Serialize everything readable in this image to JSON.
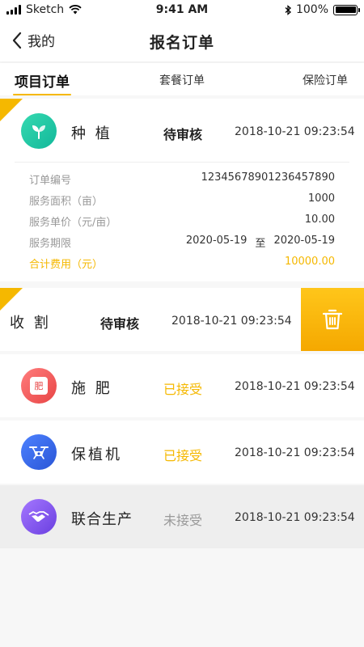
{
  "status_bar": {
    "carrier": "Sketch",
    "time": "9:41 AM",
    "battery": "100%",
    "battery_level": 1.0
  },
  "nav": {
    "back_label": "我的",
    "title": "报名订单"
  },
  "tabs": [
    {
      "label": "项目订单",
      "active": true
    },
    {
      "label": "套餐订单",
      "active": false
    },
    {
      "label": "保险订单",
      "active": false
    }
  ],
  "colors": {
    "accent": "#f5b800",
    "plant": "#22c4a0",
    "fertilize": "#f05a5a",
    "drone": "#3b6df0",
    "joint": "#7a55e8"
  },
  "orders": [
    {
      "name": "种 植",
      "status": "待审核",
      "datetime": "2018-10-21 09:23:54",
      "icon": "sprout-icon",
      "details": {
        "order_no_label": "订单编号",
        "order_no": "12345678901236457890",
        "area_label": "服务面积（亩）",
        "area": "1000",
        "price_label": "服务单价（元/亩）",
        "price": "10.00",
        "period_label": "服务期限",
        "period_start": "2020-05-19",
        "period_sep": "至",
        "period_end": "2020-05-19",
        "total_label": "合计费用（元）",
        "total": "10000.00"
      }
    },
    {
      "name": "收 割",
      "status": "待审核",
      "datetime": "2018-10-21 09:23:54",
      "icon": "none"
    },
    {
      "name": "施 肥",
      "status": "已接受",
      "datetime": "2018-10-21 09:23:54",
      "icon": "fertilizer-icon",
      "icon_text": "肥"
    },
    {
      "name": "保植机",
      "status": "已接受",
      "datetime": "2018-10-21 09:23:54",
      "icon": "drone-icon"
    },
    {
      "name": "联合生产",
      "status": "未接受",
      "datetime": "2018-10-21 09:23:54",
      "icon": "handshake-icon"
    }
  ],
  "delete_icon": "trash-icon"
}
